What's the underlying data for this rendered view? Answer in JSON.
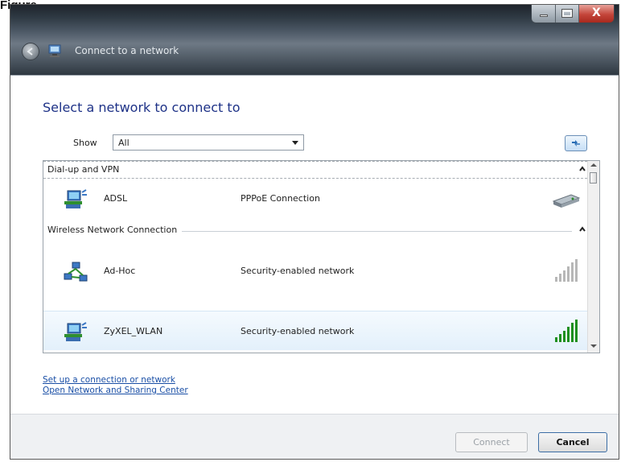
{
  "figure_label": "Figure",
  "window": {
    "title": "Connect to a network",
    "close_glyph": "X"
  },
  "heading": "Select a network to connect to",
  "show": {
    "label": "Show",
    "value": "All"
  },
  "groups": [
    {
      "label": "Dial-up and VPN",
      "items": [
        {
          "name": "ADSL",
          "desc": "PPPoE Connection",
          "icon": "network-computer-icon",
          "signal": "modem-icon"
        }
      ]
    },
    {
      "label": "Wireless Network Connection",
      "items": [
        {
          "name": "Ad-Hoc",
          "desc": "Security-enabled network",
          "icon": "adhoc-network-icon",
          "signal": "signal-bars-weak-icon"
        },
        {
          "name": "ZyXEL_WLAN",
          "desc": "Security-enabled network",
          "icon": "network-computer-icon",
          "signal": "signal-bars-strong-icon"
        }
      ]
    }
  ],
  "links": {
    "setup": "Set up a connection or network",
    "sharing": "Open Network and Sharing Center"
  },
  "buttons": {
    "connect": "Connect",
    "cancel": "Cancel"
  },
  "colors": {
    "heading": "#1e3287",
    "link": "#1a4fa6",
    "signal_strong": "#1f8f1f"
  }
}
